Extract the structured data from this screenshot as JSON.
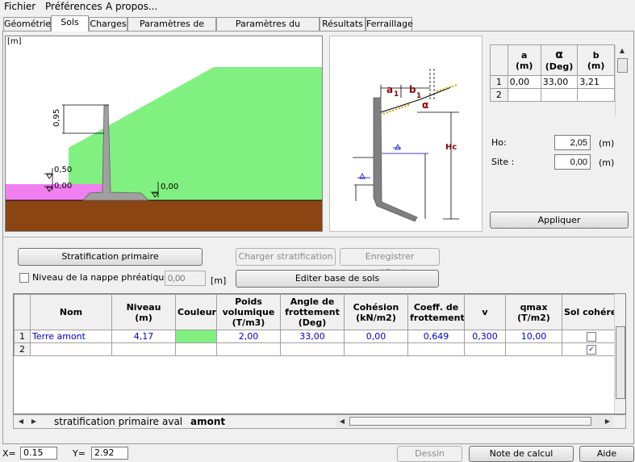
{
  "menu": {
    "items": [
      "Fichier",
      "Préférences",
      "A propos..."
    ]
  },
  "tabs": [
    "Géométrie",
    "Sols",
    "Charges",
    "Paramètres de calcul",
    "Paramètres du ferraillage",
    "Résultats",
    "Ferraillage"
  ],
  "active_tab": "Sols",
  "drawing": {
    "unit": "[m]",
    "dim_095": "0,95",
    "level_050": "0,50",
    "level_000_left": "0,00",
    "level_000_right": "0,00",
    "colors": {
      "fill_ground": "#8b4513",
      "backfill": "#80f080",
      "water": "#f080f0",
      "wall": "#a0a0a0"
    }
  },
  "schema": {
    "a1": "a",
    "a1_sub": "1",
    "b1": "b",
    "b1_sub": "1",
    "alpha": "α",
    "hc": "Hc"
  },
  "slope_table": {
    "headers": [
      [
        "a",
        "(m)"
      ],
      [
        "α",
        "(Deg)"
      ],
      [
        "b",
        "(m)"
      ]
    ],
    "rows": [
      {
        "num": "1",
        "a": "0,00",
        "alpha": "33,00",
        "b": "3,21"
      },
      {
        "num": "2",
        "a": "",
        "alpha": "",
        "b": ""
      }
    ]
  },
  "ho": {
    "label": "Ho:",
    "value": "2,05",
    "unit": "(m)"
  },
  "site": {
    "label": "Site :",
    "value": "0,00",
    "unit": "(m)"
  },
  "buttons": {
    "appliquer": "Appliquer",
    "stratification_primaire": "Stratification primaire",
    "charger": "Charger stratification",
    "enregistrer": "Enregistrer stratification",
    "editer": "Editer base de sols",
    "dessin": "Dessin",
    "note": "Note de calcul",
    "aide": "Aide"
  },
  "nappe": {
    "label": "Niveau de la nappe phréatique :",
    "value": "0,00",
    "unit": "[m]"
  },
  "soil_table": {
    "headers": [
      "Nom",
      "Niveau\n(m)",
      "Couleur",
      "Poids\nvolumique\n(T/m3)",
      "Angle de\nfrottement\n(Deg)",
      "Cohésion\n(kN/m2)",
      "Coeff. de\nfrottement",
      "v",
      "qmax\n(T/m2)",
      "Sol cohére"
    ],
    "rows": [
      {
        "num": "1",
        "nom": "Terre amont",
        "niveau": "4,17",
        "couleur": "#80f080",
        "poids": "2,00",
        "angle": "33,00",
        "cohesion": "0,00",
        "coeff": "0,649",
        "v": "0,300",
        "qmax": "10,00",
        "coherent": false
      },
      {
        "num": "2",
        "nom": "",
        "niveau": "",
        "couleur": "",
        "poids": "",
        "angle": "",
        "cohesion": "",
        "coeff": "",
        "v": "",
        "qmax": "",
        "coherent": true
      }
    ]
  },
  "sheet_tabs": [
    "stratification primaire",
    "aval",
    "amont"
  ],
  "active_sheet": "amont",
  "status": {
    "x_label": "X=",
    "x_value": "0.15",
    "y_label": "Y=",
    "y_value": "2.92"
  }
}
